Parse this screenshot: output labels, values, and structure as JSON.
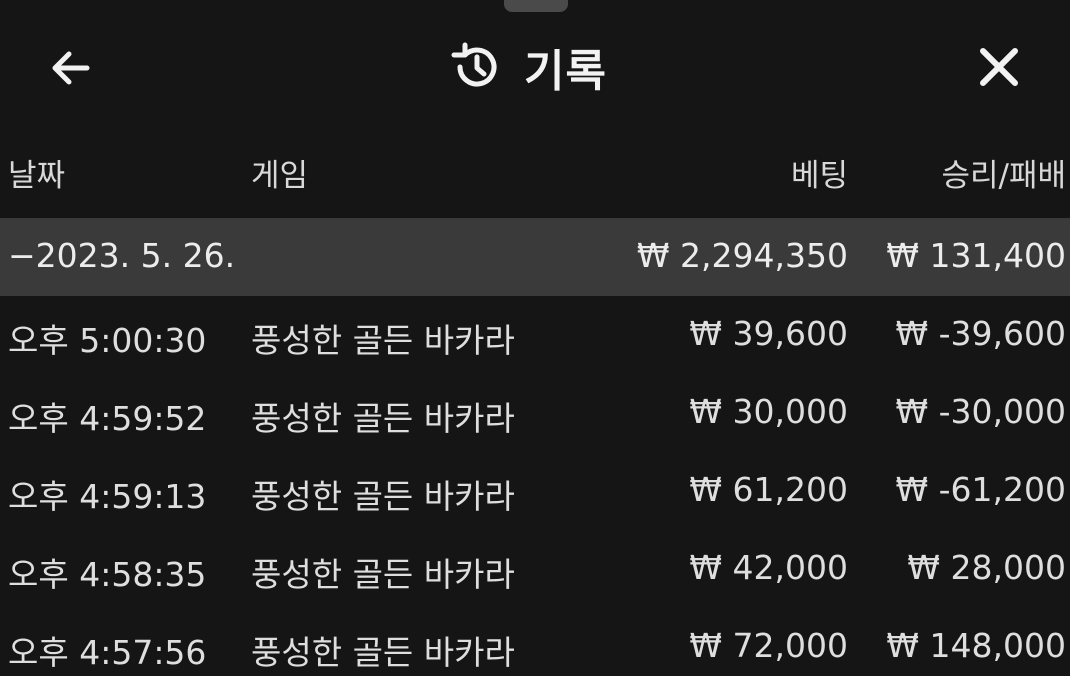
{
  "header": {
    "title": "기록"
  },
  "columns": {
    "date": "날짜",
    "game": "게임",
    "bet": "베팅",
    "win_loss": "승리/패배"
  },
  "summary": {
    "date": "−2023. 5. 26.",
    "bet": "₩ 2,294,350",
    "win_loss": "₩ 131,400"
  },
  "rows": [
    {
      "time": "오후 5:00:30",
      "game": "풍성한 골든 바카라",
      "bet": "₩ 39,600",
      "win_loss": "₩ -39,600"
    },
    {
      "time": "오후 4:59:52",
      "game": "풍성한 골든 바카라",
      "bet": "₩ 30,000",
      "win_loss": "₩ -30,000"
    },
    {
      "time": "오후 4:59:13",
      "game": "풍성한 골든 바카라",
      "bet": "₩ 61,200",
      "win_loss": "₩ -61,200"
    },
    {
      "time": "오후 4:58:35",
      "game": "풍성한 골든 바카라",
      "bet": "₩ 42,000",
      "win_loss": "₩ 28,000"
    },
    {
      "time": "오후 4:57:56",
      "game": "풍성한 골든 바카라",
      "bet": "₩ 72,000",
      "win_loss": "₩ 148,000"
    }
  ],
  "icons": {
    "back": "arrow-left-icon",
    "history": "history-icon",
    "close": "close-icon"
  }
}
